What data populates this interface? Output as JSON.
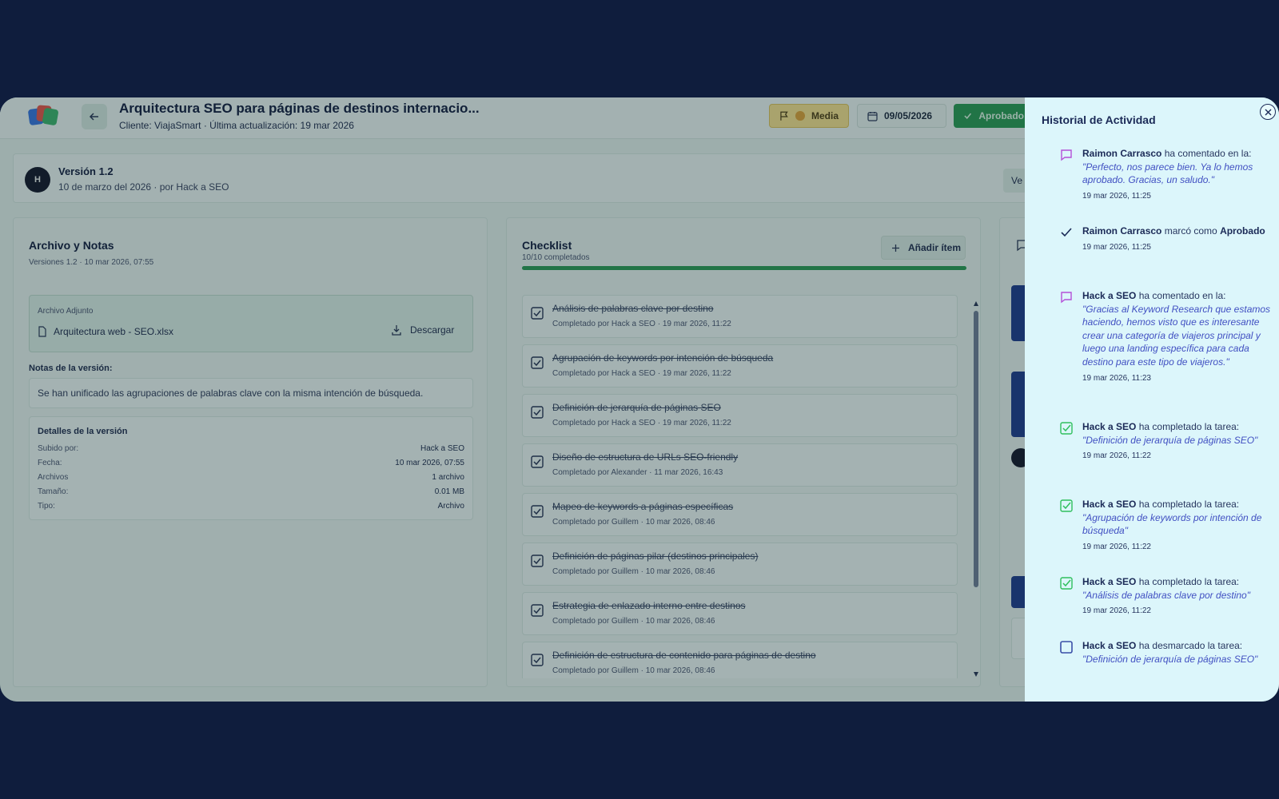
{
  "header": {
    "title": "Arquitectura SEO para páginas de destinos internacio...",
    "subtitle": "Cliente: ViajaSmart · Última actualización: 19 mar 2026",
    "priority": "Media",
    "date": "09/05/2026",
    "status": "Aprobado"
  },
  "version": {
    "avatar_text": "H",
    "title": "Versión 1.2",
    "subtitle": "10 de marzo del 2026 · por Hack a SEO",
    "button": "Ve"
  },
  "files_panel": {
    "title": "Archivo y Notas",
    "subtitle": "Versiones 1.2 · 10 mar 2026, 07:55",
    "attachment_label": "Archivo Adjunto",
    "file_name": "Arquitectura web - SEO.xlsx",
    "download_label": "Descargar",
    "notes_label": "Notas de la versión:",
    "notes_text": "Se han unificado las agrupaciones de palabras clave con la misma intención de búsqueda.",
    "details_title": "Detalles de la versión",
    "details": [
      {
        "key": "Subido por:",
        "value": "Hack a SEO"
      },
      {
        "key": "Fecha:",
        "value": "10 mar 2026, 07:55"
      },
      {
        "key": "Archivos",
        "value": "1 archivo"
      },
      {
        "key": "Tamaño:",
        "value": "0.01 MB"
      },
      {
        "key": "Tipo:",
        "value": "Archivo"
      }
    ]
  },
  "checklist": {
    "title": "Checklist",
    "subtitle": "10/10 completados",
    "add_label": "Añadir ítem",
    "progress": 1.0,
    "items": [
      {
        "title": "Análisis de palabras clave por destino",
        "meta": "Completado por Hack a SEO · 19 mar 2026, 11:22"
      },
      {
        "title": "Agrupación de keywords por intención de búsqueda",
        "meta": "Completado por Hack a SEO · 19 mar 2026, 11:22"
      },
      {
        "title": "Definición de jerarquía de páginas SEO",
        "meta": "Completado por Hack a SEO · 19 mar 2026, 11:22"
      },
      {
        "title": "Diseño de estructura de URLs SEO-friendly",
        "meta": "Completado por Alexander · 11 mar 2026, 16:43"
      },
      {
        "title": "Mapeo de keywords a páginas específicas",
        "meta": "Completado por Guillem · 10 mar 2026, 08:46"
      },
      {
        "title": "Definición de páginas pilar (destinos principales)",
        "meta": "Completado por Guillem · 10 mar 2026, 08:46"
      },
      {
        "title": "Estrategia de enlazado interno entre destinos",
        "meta": "Completado por Guillem · 10 mar 2026, 08:46"
      },
      {
        "title": "Definición de estructura de contenido para páginas de destino",
        "meta": "Completado por Guillem · 10 mar 2026, 08:46"
      }
    ]
  },
  "activity": {
    "title": "Historial de Actividad",
    "entries": [
      {
        "icon": "comment-icon",
        "actor": "Raimon Carrasco",
        "action": " ha comentado en la:",
        "quote": "\"Perfecto, nos parece bien. Ya lo hemos aprobado. Gracias, un saludo.\"",
        "time": "19 mar 2026, 11:25"
      },
      {
        "icon": "check-icon",
        "actor": "Raimon Carrasco",
        "action": " marcó como ",
        "strong": "Aprobado",
        "time": "19 mar 2026, 11:25"
      },
      {
        "icon": "comment-icon",
        "actor": "Hack a SEO",
        "action": " ha comentado en la:",
        "quote": "\"Gracias al Keyword Research que estamos haciendo, hemos visto que es interesante crear una categoría de viajeros principal y luego una landing específica para cada destino para este tipo de viajeros.\"",
        "time": "19 mar 2026, 11:23"
      },
      {
        "icon": "checkbox-checked-icon",
        "actor": "Hack a SEO",
        "action": " ha completado la tarea:",
        "quote": "\"Definición de jerarquía de páginas SEO\"",
        "time": "19 mar 2026, 11:22"
      },
      {
        "icon": "checkbox-checked-icon",
        "actor": "Hack a SEO",
        "action": " ha completado la tarea:",
        "quote": "\"Agrupación de keywords por intención de búsqueda\"",
        "time": "19 mar 2026, 11:22"
      },
      {
        "icon": "checkbox-checked-icon",
        "actor": "Hack a SEO",
        "action": " ha completado la tarea:",
        "quote": "\"Análisis de palabras clave por destino\"",
        "time": "19 mar 2026, 11:22"
      },
      {
        "icon": "checkbox-empty-icon",
        "actor": "Hack a SEO",
        "action": " ha desmarcado la tarea:",
        "quote": "\"Definición de jerarquía de páginas SEO\"",
        "time": ""
      }
    ]
  },
  "colors": {
    "accent": "#2f9b55",
    "drawer": "#dcf6fb",
    "comment_icon": "#b450d8",
    "check_icon": "#2fbf5c",
    "quote": "#4150c2"
  }
}
